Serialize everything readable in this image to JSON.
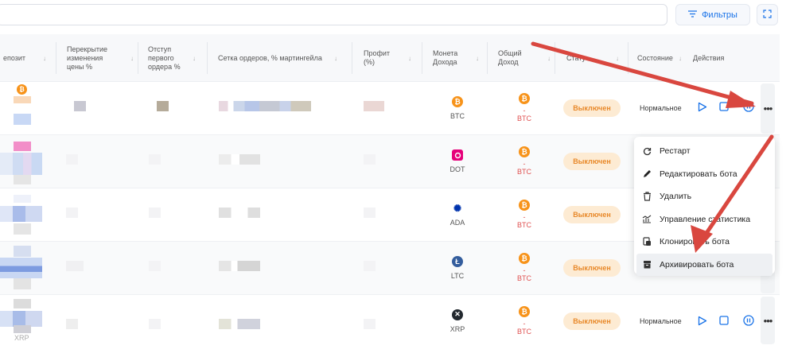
{
  "toolbar": {
    "search_placeholder": "",
    "filters_label": "Фильтры"
  },
  "columns": [
    {
      "id": "deposit",
      "label": "епозит"
    },
    {
      "id": "overlap",
      "label": "Перекрытие изменения цены %"
    },
    {
      "id": "indent",
      "label": "Отступ первого ордера %"
    },
    {
      "id": "grid",
      "label": "Сетка ордеров, % мартингейла"
    },
    {
      "id": "profit",
      "label": "Профит (%)"
    },
    {
      "id": "income_coin",
      "label": "Монета Дохода"
    },
    {
      "id": "total_income",
      "label": "Общий Доход"
    },
    {
      "id": "status",
      "label": "Стату"
    },
    {
      "id": "state",
      "label": "Состояние"
    },
    {
      "id": "actions",
      "label": "Действия"
    }
  ],
  "rows": [
    {
      "coin": "BTC",
      "coin_icon": "bitcoin-icon",
      "income_icon": "bitcoin-icon",
      "income_value": "-",
      "income_currency": "BTC",
      "status": "Выключен",
      "state": "Нормальное",
      "show_actions": true
    },
    {
      "coin": "DOT",
      "coin_icon": "polkadot-icon",
      "income_icon": "bitcoin-icon",
      "income_value": "-",
      "income_currency": "BTC",
      "status": "Выключен",
      "state": "",
      "show_actions": false
    },
    {
      "coin": "ADA",
      "coin_icon": "cardano-icon",
      "income_icon": "bitcoin-icon",
      "income_value": "-",
      "income_currency": "BTC",
      "status": "Выключен",
      "state": "",
      "show_actions": false
    },
    {
      "coin": "LTC",
      "coin_icon": "litecoin-icon",
      "income_icon": "bitcoin-icon",
      "income_value": "-",
      "income_currency": "BTC",
      "status": "Выключен",
      "state": "",
      "show_actions": false
    },
    {
      "coin": "XRP",
      "coin_icon": "ripple-icon",
      "income_icon": "bitcoin-icon",
      "income_value": "-",
      "income_currency": "BTC",
      "status": "Выключен",
      "state": "Нормальное",
      "show_actions": true
    }
  ],
  "deposit_fragment": "XRP",
  "context_menu": {
    "items": [
      {
        "label": "Рестарт",
        "icon": "restart-icon"
      },
      {
        "label": "Редактировать бота",
        "icon": "pencil-icon"
      },
      {
        "label": "Удалить",
        "icon": "trash-icon"
      },
      {
        "label": "Управление статистика",
        "icon": "stats-icon"
      },
      {
        "label": "Клонировать бота",
        "icon": "clone-icon"
      },
      {
        "label": "Архивировать бота",
        "icon": "archive-icon"
      }
    ]
  },
  "colors": {
    "accent": "#1a73e8",
    "status_bg": "#fdebd3",
    "status_text": "#e8892a",
    "negative": "#e05252",
    "arrow": "#d9473f"
  }
}
